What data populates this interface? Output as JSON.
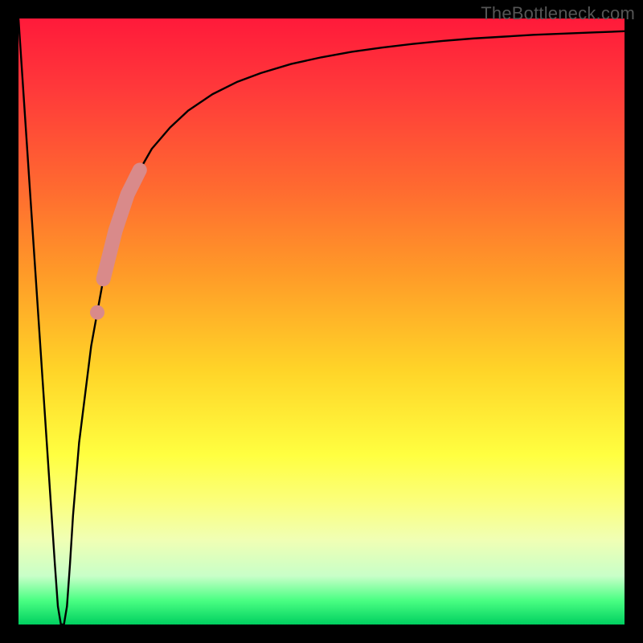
{
  "watermark": "TheBottleneck.com",
  "chart_data": {
    "type": "line",
    "title": "",
    "xlabel": "",
    "ylabel": "",
    "xlim": [
      0,
      100
    ],
    "ylim": [
      0,
      100
    ],
    "series": [
      {
        "name": "bottleneck-curve",
        "x": [
          0,
          2,
          4,
          5,
          6,
          6.5,
          7,
          7.5,
          8,
          8.5,
          9,
          10,
          12,
          14,
          16,
          18,
          20,
          22,
          25,
          28,
          32,
          36,
          40,
          45,
          50,
          55,
          60,
          65,
          70,
          75,
          80,
          85,
          90,
          95,
          100
        ],
        "values": [
          100,
          70,
          40,
          25,
          10,
          3,
          0,
          0,
          3,
          10,
          18,
          30,
          46,
          57,
          65,
          71,
          75,
          78.5,
          82,
          84.8,
          87.5,
          89.5,
          91,
          92.5,
          93.6,
          94.5,
          95.2,
          95.8,
          96.3,
          96.7,
          97,
          97.3,
          97.5,
          97.7,
          97.9
        ]
      }
    ],
    "highlight_segment": {
      "series": "bottleneck-curve",
      "x_start": 14,
      "x_end": 20,
      "color": "#d98a8a"
    },
    "highlight_dot": {
      "series": "bottleneck-curve",
      "x": 13,
      "color": "#d98a8a"
    },
    "gradient_background": {
      "stops": [
        {
          "pos": 0.0,
          "color": "#ff1a3a"
        },
        {
          "pos": 0.28,
          "color": "#ff6a30"
        },
        {
          "pos": 0.58,
          "color": "#ffd428"
        },
        {
          "pos": 0.8,
          "color": "#fbff7e"
        },
        {
          "pos": 0.96,
          "color": "#4bff83"
        },
        {
          "pos": 1.0,
          "color": "#00d060"
        }
      ]
    }
  }
}
